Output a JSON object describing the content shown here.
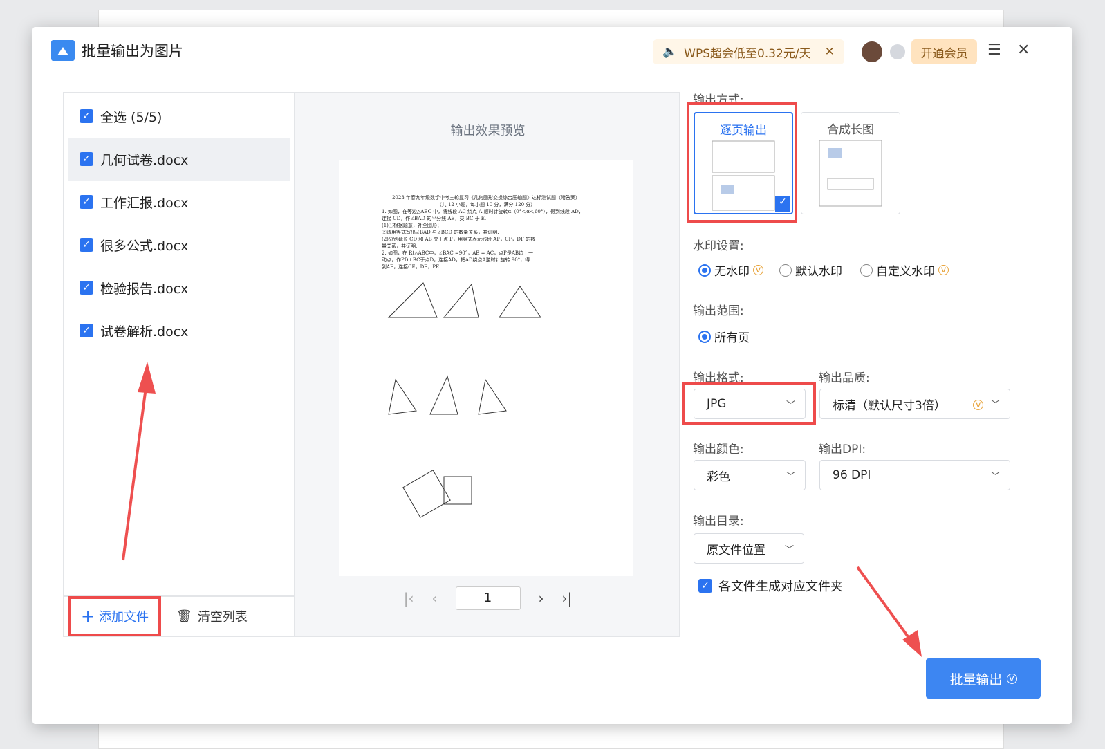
{
  "title": "批量输出为图片",
  "promo": {
    "text": "WPS超会低至0.32元/天"
  },
  "vip_label": "开通会员",
  "files": {
    "select_all": "全选 (5/5)",
    "items": [
      "几何试卷.docx",
      "工作汇报.docx",
      "很多公式.docx",
      "检验报告.docx",
      "试卷解析.docx"
    ],
    "add": "添加文件",
    "clear": "清空列表"
  },
  "preview": {
    "title": "输出效果预览",
    "page": "1",
    "lines": [
      "2023 年春九年级数学中考三轮复习《几何图形变换综合压轴题》达标测试题（附答案）",
      "（共 12 小题，每小题 10 分，满分 120 分）",
      "1. 如图，在等边△ABC 中，将线段 AC 绕点 A 顺时针旋转α（0°＜α＜60°），得到线段 AD，",
      "连接 CD，作∠BAD 的平分线 AE，交 BC 于 E.",
      "(1)①根据题意，补全图形；",
      "②请用等式写出∠BAD 与∠BCD 的数量关系，并证明.",
      "(2)分别延长 CD 和 AB 交于点 F，用等式表示线段 AF，CF，DF 的数",
      "量关系，并证明.",
      "2. 如图，在 Rt△ABC中，∠BAC =90°，AB = AC，点P是AB边上一",
      "动点，作PD⊥BC于点D，连接AD，把AD绕点A逆时针旋转 90°，得",
      "到AE，连接CE，DE，PE."
    ]
  },
  "settings": {
    "mode_label": "输出方式:",
    "modes": [
      "逐页输出",
      "合成长图"
    ],
    "watermark_label": "水印设置:",
    "watermarks": [
      "无水印",
      "默认水印",
      "自定义水印"
    ],
    "range_label": "输出范围:",
    "range": "所有页",
    "format_label": "输出格式:",
    "format": "JPG",
    "quality_label": "输出品质:",
    "quality": "标清（默认尺寸3倍）",
    "color_label": "输出颜色:",
    "color": "彩色",
    "dpi_label": "输出DPI:",
    "dpi": "96 DPI",
    "dir_label": "输出目录:",
    "dir": "原文件位置",
    "folder_option": "各文件生成对应文件夹"
  },
  "export_label": "批量输出",
  "colors": {
    "accent": "#2b73f0",
    "highlight": "#ee4b4b"
  }
}
